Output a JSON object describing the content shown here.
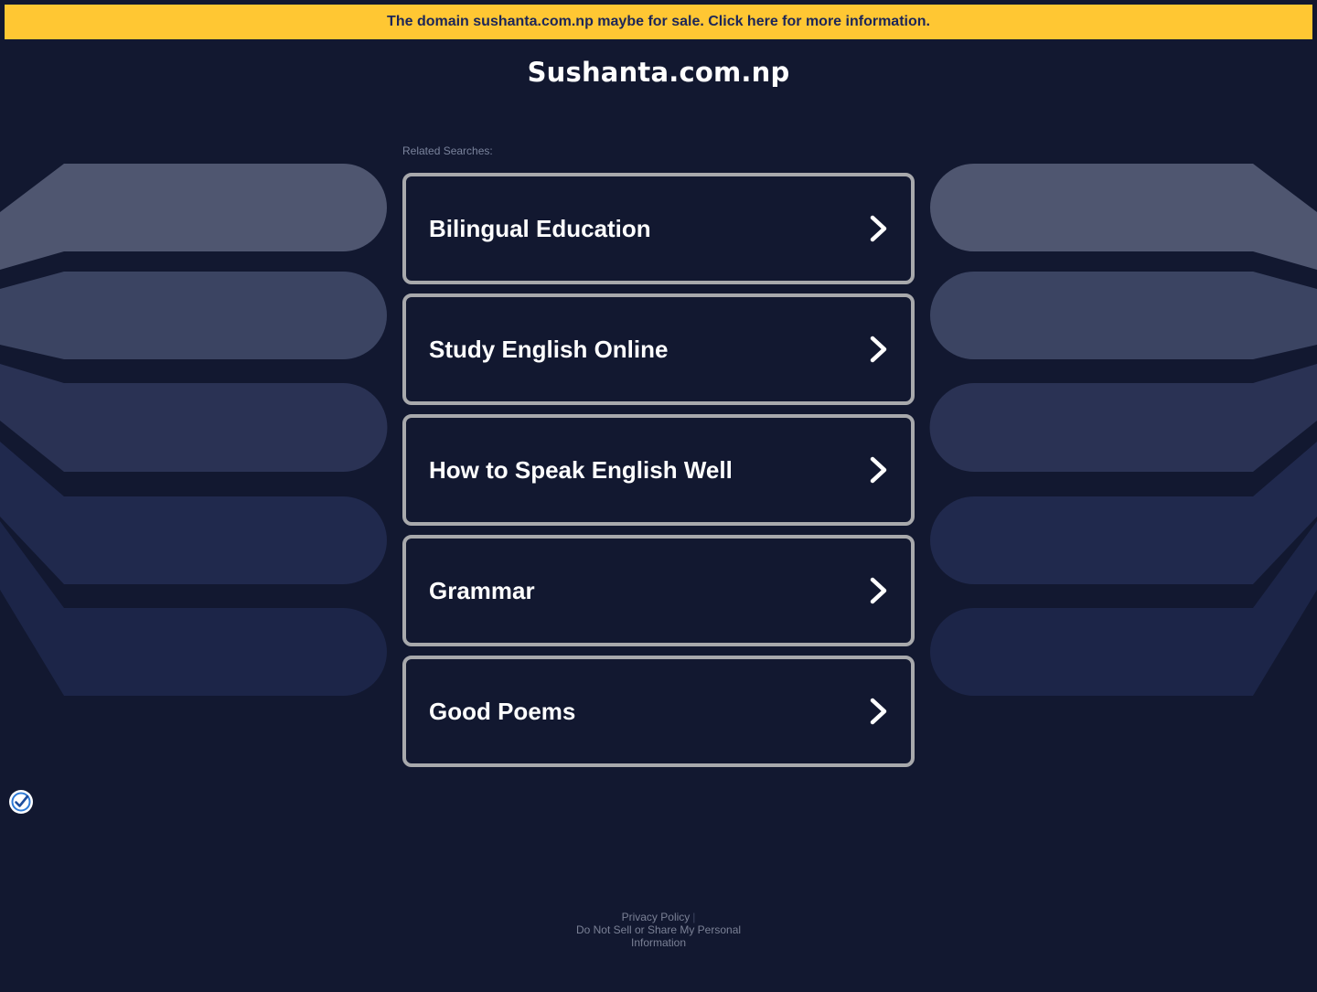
{
  "banner": {
    "text": "The domain sushanta.com.np maybe for sale. Click here for more information."
  },
  "site": {
    "title": "Sushanta.com.np"
  },
  "related": {
    "label": "Related Searches:",
    "links": [
      {
        "label": "Bilingual Education"
      },
      {
        "label": "Study English Online"
      },
      {
        "label": "How to Speak English Well"
      },
      {
        "label": "Grammar"
      },
      {
        "label": "Good Poems"
      }
    ]
  },
  "footer": {
    "privacy_policy": "Privacy Policy",
    "separator": "|",
    "do_not_sell": "Do Not Sell or Share My Personal Information"
  },
  "icons": {
    "link_arrow": "chevron-right-icon",
    "privacy_badge": "privacy-check-icon"
  },
  "colors": {
    "background": "#121830",
    "banner": "#ffc733",
    "banner_text": "#1c2658",
    "link_border": "#a8a9ac",
    "band_1": "#4f5670",
    "band_2": "#3b4462",
    "band_3": "#2a3254",
    "band_4": "#20294d",
    "band_5": "#1c2548"
  }
}
